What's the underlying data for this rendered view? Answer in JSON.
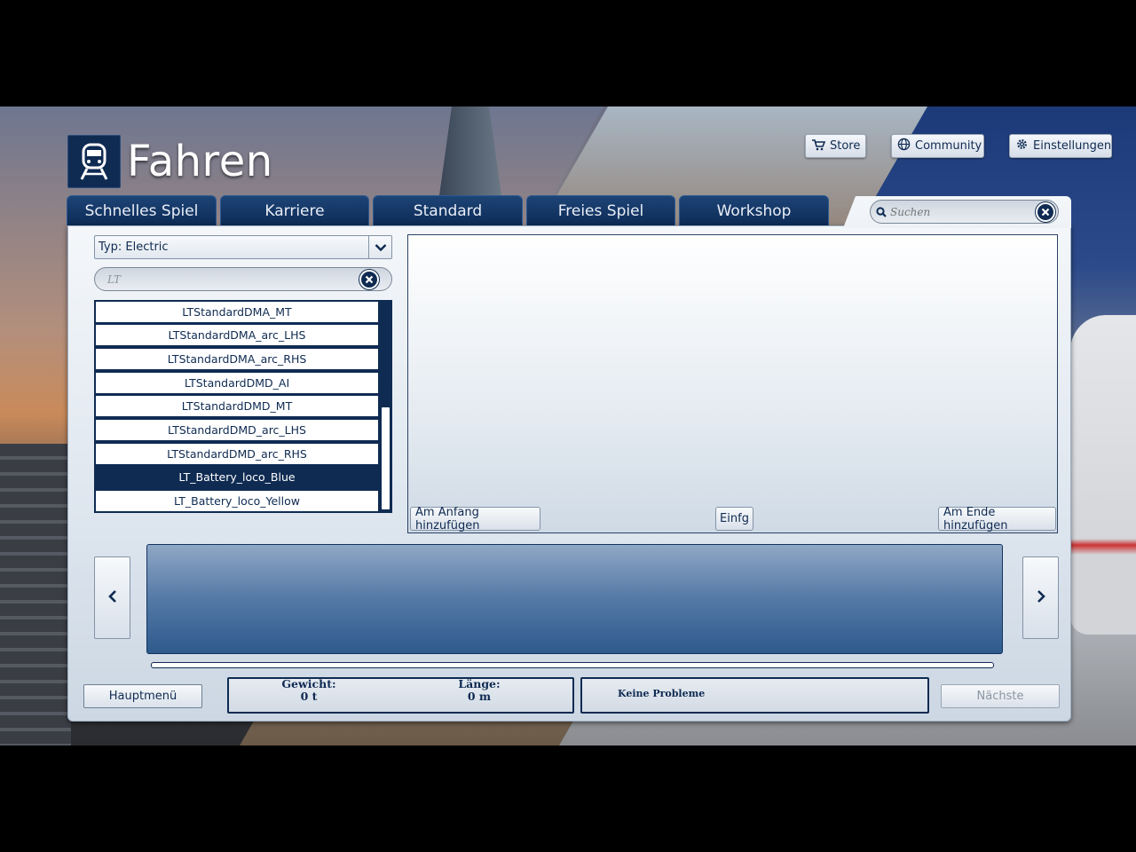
{
  "header": {
    "title": "Fahren",
    "logo_icon": "train-icon"
  },
  "top_buttons": {
    "store": {
      "label": "Store",
      "icon": "cart-icon"
    },
    "community": {
      "label": "Community",
      "icon": "globe-icon"
    },
    "settings": {
      "label": "Einstellungen",
      "icon": "gear-icon"
    }
  },
  "tabs": [
    {
      "label": "Schnelles Spiel"
    },
    {
      "label": "Karriere"
    },
    {
      "label": "Standard"
    },
    {
      "label": "Freies Spiel"
    },
    {
      "label": "Workshop"
    }
  ],
  "search": {
    "placeholder": "Suchen",
    "value": ""
  },
  "filter": {
    "type_select": "Typ: Electric",
    "query": "LT"
  },
  "vehicle_list": {
    "items": [
      {
        "label": "LTStandardDMA_MT",
        "selected": false
      },
      {
        "label": "LTStandardDMA_arc_LHS",
        "selected": false
      },
      {
        "label": "LTStandardDMA_arc_RHS",
        "selected": false
      },
      {
        "label": "LTStandardDMD_AI",
        "selected": false
      },
      {
        "label": "LTStandardDMD_MT",
        "selected": false
      },
      {
        "label": "LTStandardDMD_arc_LHS",
        "selected": false
      },
      {
        "label": "LTStandardDMD_arc_RHS",
        "selected": false
      },
      {
        "label": "LT_Battery_loco_Blue",
        "selected": true
      },
      {
        "label": "LT_Battery_loco_Yellow",
        "selected": false
      }
    ]
  },
  "preview_actions": {
    "add_start": "Am Anfang hinzufügen",
    "insert": "Einfg",
    "add_end": "Am Ende hinzufügen"
  },
  "footer": {
    "main_menu": "Hauptmenü",
    "weight_label": "Gewicht:",
    "weight_value": "0 t",
    "length_label": "Länge:",
    "length_value": "0 m",
    "status": "Keine Probleme",
    "next": "Nächste"
  },
  "colors": {
    "navy": "#0f2b52",
    "panel": "#e6ecf2",
    "consist_area": "#2e5a8c"
  }
}
